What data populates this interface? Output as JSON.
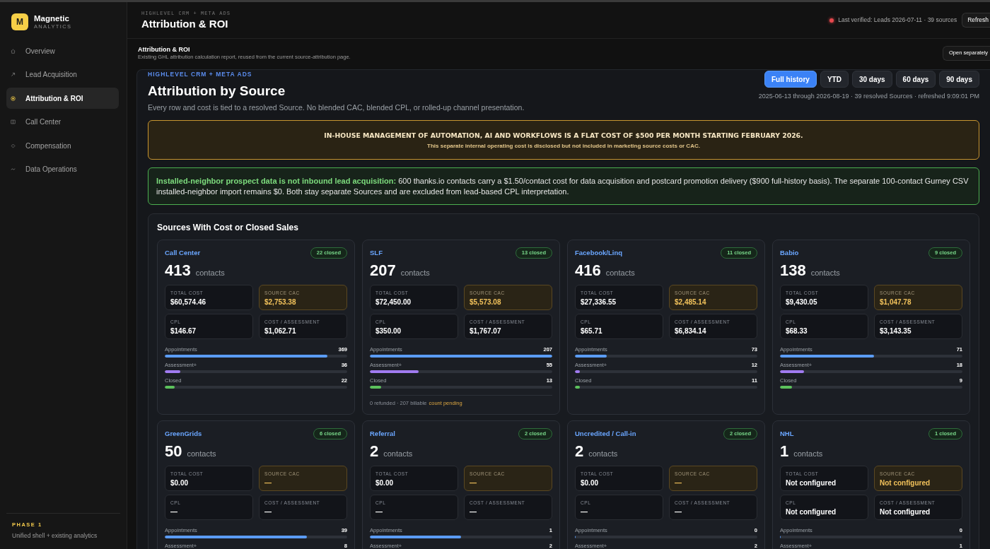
{
  "sidebar": {
    "brand": {
      "logo": "M",
      "name": "Magnetic",
      "tagline": "ANALYTICS"
    },
    "items": [
      {
        "label": "Overview",
        "selected": false
      },
      {
        "label": "Lead Acquisition",
        "selected": false
      },
      {
        "label": "Attribution & ROI",
        "selected": true
      },
      {
        "label": "Call Center",
        "selected": false
      },
      {
        "label": "Compensation",
        "selected": false
      },
      {
        "label": "Data Operations",
        "selected": false
      }
    ],
    "footer": {
      "phase": "PHASE 1",
      "description": "Unified shell + existing analytics"
    }
  },
  "header": {
    "eyebrow": "HIGHLEVEL CRM + META ADS",
    "title": "Attribution & ROI",
    "status": "Last verified: Leads 2026-07-11 · 39 sources",
    "refresh_button": "Refresh"
  },
  "report_bar": {
    "title": "Attribution & ROI",
    "description": "Existing GHL attribution calculation report, reused from the current source-attribution page.",
    "open_button": "Open separately"
  },
  "report": {
    "eyebrow": "HIGHLEVEL CRM + META ADS",
    "title": "Attribution by Source",
    "subtitle": "Every row and cost is tied to a resolved Source. No blended CAC, blended CPL, or rolled-up channel presentation.",
    "ranges": [
      {
        "label": "Full history",
        "selected": true
      },
      {
        "label": "YTD",
        "selected": false
      },
      {
        "label": "30 days",
        "selected": false
      },
      {
        "label": "60 days",
        "selected": false
      },
      {
        "label": "90 days",
        "selected": false
      }
    ],
    "range_summary": "2025-06-13 through 2026-08-19 · 39 resolved Sources · refreshed 9:09:01 PM",
    "notice": {
      "heading": "IN-HOUSE MANAGEMENT OF AUTOMATION, AI AND WORKFLOWS IS A FLAT COST OF $500 PER MONTH STARTING FEBRUARY 2026.",
      "text": "This separate internal operating cost is disclosed but not included in marketing source costs or CAC."
    },
    "callout": "**Installed-neighbor prospect data is not inbound lead acquisition:** 600 thanks.io contacts carry a $1.50/contact cost for data acquisition and postcard promotion delivery ($900 full-history basis). The separate 100-contact Gurney CSV installed-neighbor import remains $0. Both stay separate Sources and are excluded from lead-based CPL interpretation.",
    "section_title": "Sources With Cost or Closed Sales",
    "sources": [
      {
        "name": "Call Center",
        "closed": "22 closed",
        "contacts": "413",
        "contacts_label": "contacts",
        "metrics": [
          {
            "label": "TOTAL COST",
            "value": "$60,574.46",
            "kind": "plain"
          },
          {
            "label": "SOURCE CAC",
            "value": "$2,753.38",
            "kind": "highlight"
          },
          {
            "label": "CPL",
            "value": "$146.67",
            "kind": "plain"
          },
          {
            "label": "COST / ASSESSMENT",
            "value": "$1,062.71",
            "kind": "plain"
          }
        ],
        "funnel": [
          {
            "label": "Appointments",
            "value": "369",
            "level": 0.893
          },
          {
            "label": "Assessment+",
            "value": "36",
            "level": 0.087
          },
          {
            "label": "Closed",
            "value": "22",
            "level": 0.053
          }
        ]
      },
      {
        "name": "SLF",
        "closed": "13 closed",
        "contacts": "207",
        "contacts_label": "contacts",
        "metrics": [
          {
            "label": "TOTAL COST",
            "value": "$72,450.00",
            "kind": "plain"
          },
          {
            "label": "SOURCE CAC",
            "value": "$5,573.08",
            "kind": "highlight"
          },
          {
            "label": "CPL",
            "value": "$350.00",
            "kind": "plain"
          },
          {
            "label": "COST / ASSESSMENT",
            "value": "$1,767.07",
            "kind": "plain"
          }
        ],
        "funnel": [
          {
            "label": "Appointments",
            "value": "207",
            "level": 1
          },
          {
            "label": "Assessment+",
            "value": "55",
            "level": 0.266
          },
          {
            "label": "Closed",
            "value": "13",
            "level": 0.063
          }
        ],
        "note": {
          "text": "0 refunded · 207 billable",
          "status": "count pending"
        }
      },
      {
        "name": "Facebook/Linq",
        "closed": "11 closed",
        "contacts": "416",
        "contacts_label": "contacts",
        "metrics": [
          {
            "label": "TOTAL COST",
            "value": "$27,336.55",
            "kind": "plain"
          },
          {
            "label": "SOURCE CAC",
            "value": "$2,485.14",
            "kind": "highlight"
          },
          {
            "label": "CPL",
            "value": "$65.71",
            "kind": "plain"
          },
          {
            "label": "COST / ASSESSMENT",
            "value": "$6,834.14",
            "kind": "plain"
          }
        ],
        "funnel": [
          {
            "label": "Appointments",
            "value": "73",
            "level": 0.175
          },
          {
            "label": "Assessment+",
            "value": "12",
            "level": 0.029
          },
          {
            "label": "Closed",
            "value": "11",
            "level": 0.026
          }
        ]
      },
      {
        "name": "Babio",
        "closed": "9 closed",
        "contacts": "138",
        "contacts_label": "contacts",
        "metrics": [
          {
            "label": "TOTAL COST",
            "value": "$9,430.05",
            "kind": "plain"
          },
          {
            "label": "SOURCE CAC",
            "value": "$1,047.78",
            "kind": "highlight"
          },
          {
            "label": "CPL",
            "value": "$68.33",
            "kind": "plain"
          },
          {
            "label": "COST / ASSESSMENT",
            "value": "$3,143.35",
            "kind": "plain"
          }
        ],
        "funnel": [
          {
            "label": "Appointments",
            "value": "71",
            "level": 0.514
          },
          {
            "label": "Assessment+",
            "value": "18",
            "level": 0.13
          },
          {
            "label": "Closed",
            "value": "9",
            "level": 0.065
          }
        ]
      },
      {
        "name": "GreenGrids",
        "closed": "6 closed",
        "contacts": "50",
        "contacts_label": "contacts",
        "metrics": [
          {
            "label": "TOTAL COST",
            "value": "$0.00",
            "kind": "plain"
          },
          {
            "label": "SOURCE CAC",
            "value": "—",
            "kind": "highlight"
          },
          {
            "label": "CPL",
            "value": "—",
            "kind": "plain"
          },
          {
            "label": "COST / ASSESSMENT",
            "value": "—",
            "kind": "plain"
          }
        ],
        "funnel": [
          {
            "label": "Appointments",
            "value": "39",
            "level": 0.78
          },
          {
            "label": "Assessment+",
            "value": "8"
          }
        ]
      },
      {
        "name": "Referral",
        "closed": "2 closed",
        "contacts": "2",
        "contacts_label": "contacts",
        "metrics": [
          {
            "label": "TOTAL COST",
            "value": "$0.00",
            "kind": "plain"
          },
          {
            "label": "SOURCE CAC",
            "value": "—",
            "kind": "highlight"
          },
          {
            "label": "CPL",
            "value": "—",
            "kind": "plain"
          },
          {
            "label": "COST / ASSESSMENT",
            "value": "—",
            "kind": "plain"
          }
        ],
        "funnel": [
          {
            "label": "Appointments",
            "value": "1",
            "level": 0.5
          },
          {
            "label": "Assessment+",
            "value": "2"
          }
        ]
      },
      {
        "name": "Uncredited / Call-in",
        "closed": "2 closed",
        "contacts": "2",
        "contacts_label": "contacts",
        "metrics": [
          {
            "label": "TOTAL COST",
            "value": "$0.00",
            "kind": "plain"
          },
          {
            "label": "SOURCE CAC",
            "value": "—",
            "kind": "highlight"
          },
          {
            "label": "CPL",
            "value": "—",
            "kind": "plain"
          },
          {
            "label": "COST / ASSESSMENT",
            "value": "—",
            "kind": "plain"
          }
        ],
        "funnel": [
          {
            "label": "Appointments",
            "value": "0",
            "level": 0
          },
          {
            "label": "Assessment+",
            "value": "2"
          }
        ]
      },
      {
        "name": "NHL",
        "closed": "1 closed",
        "contacts": "1",
        "contacts_label": "contacts",
        "metrics": [
          {
            "label": "TOTAL COST",
            "value": "Not configured",
            "kind": "plain"
          },
          {
            "label": "SOURCE CAC",
            "value": "Not configured",
            "kind": "highlight"
          },
          {
            "label": "CPL",
            "value": "Not configured",
            "kind": "plain"
          },
          {
            "label": "COST / ASSESSMENT",
            "value": "Not configured",
            "kind": "plain"
          }
        ],
        "funnel": [
          {
            "label": "Appointments",
            "value": "0",
            "level": 0
          },
          {
            "label": "Assessment+",
            "value": "1"
          }
        ]
      }
    ]
  }
}
